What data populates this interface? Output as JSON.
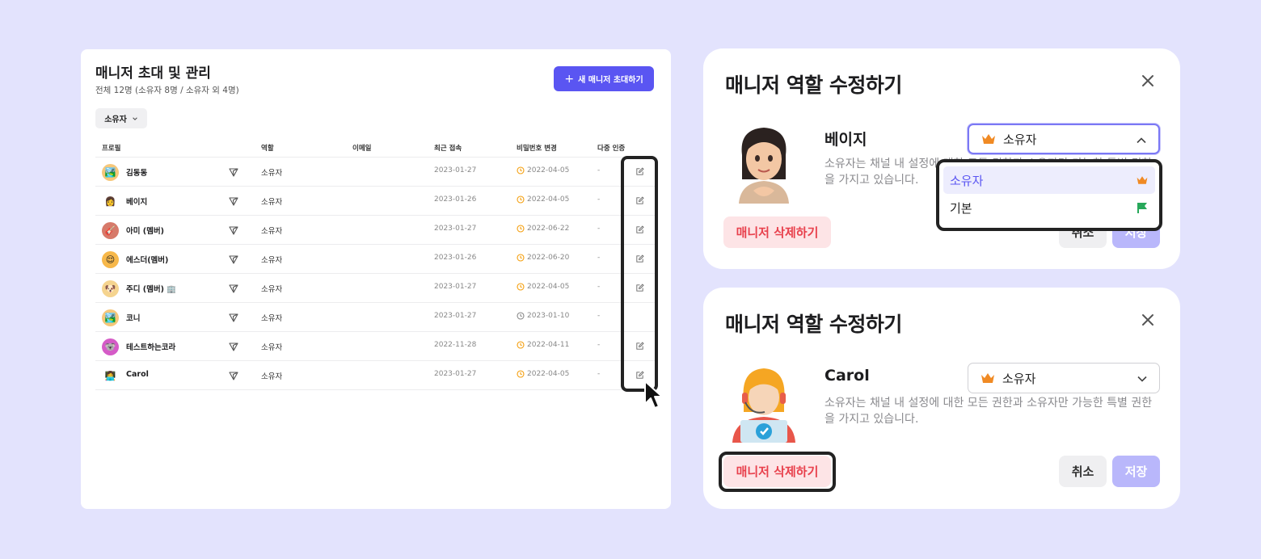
{
  "left_panel": {
    "title": "매니저 초대 및 관리",
    "subtitle": "전체 12명 (소유자 8명 / 소유자 외 4명)",
    "invite_button": "새 매니저 초대하기",
    "filter_label": "소유자",
    "columns": [
      "프로필",
      "역할",
      "이메일",
      "최근 접속",
      "비밀번호 변경",
      "다중 인증"
    ],
    "rows": [
      {
        "name": "김동동",
        "avatar": "🏞️",
        "avatar_bg": "#f6c77a",
        "role": "소유자",
        "last_login": "2023-01-27",
        "pw_changed": "2022-04-05",
        "pw_warn": true,
        "mfa": "-",
        "editable": true
      },
      {
        "name": "베이지",
        "avatar": "👩",
        "avatar_bg": "#ffffff",
        "role": "소유자",
        "last_login": "2023-01-26",
        "pw_changed": "2022-04-05",
        "pw_warn": true,
        "mfa": "-",
        "editable": true
      },
      {
        "name": "아미 (멤버)",
        "avatar": "🎸",
        "avatar_bg": "#d77a6a",
        "role": "소유자",
        "last_login": "2023-01-27",
        "pw_changed": "2022-06-22",
        "pw_warn": true,
        "mfa": "-",
        "editable": true
      },
      {
        "name": "에스더(멤버)",
        "avatar": "😌",
        "avatar_bg": "#f7b84a",
        "role": "소유자",
        "last_login": "2023-01-26",
        "pw_changed": "2022-06-20",
        "pw_warn": true,
        "mfa": "-",
        "editable": true
      },
      {
        "name": "주디 (멤버) 🏢",
        "avatar": "🐶",
        "avatar_bg": "#f5d48f",
        "role": "소유자",
        "last_login": "2023-01-27",
        "pw_changed": "2022-04-05",
        "pw_warn": true,
        "mfa": "-",
        "editable": true
      },
      {
        "name": "코니",
        "avatar": "🏞️",
        "avatar_bg": "#f6c77a",
        "role": "소유자",
        "last_login": "2023-01-27",
        "pw_changed": "2023-01-10",
        "pw_warn": false,
        "mfa": "-",
        "editable": false
      },
      {
        "name": "테스트하는코라",
        "avatar": "🐨",
        "avatar_bg": "#d55bc7",
        "role": "소유자",
        "last_login": "2022-11-28",
        "pw_changed": "2022-04-11",
        "pw_warn": true,
        "mfa": "-",
        "editable": true
      },
      {
        "name": "Carol",
        "avatar": "👩‍💻",
        "avatar_bg": "#ffffff",
        "role": "소유자",
        "last_login": "2023-01-27",
        "pw_changed": "2022-04-05",
        "pw_warn": true,
        "mfa": "-",
        "editable": true
      }
    ]
  },
  "modal_top": {
    "title": "매니저 역할 수정하기",
    "name": "베이지",
    "selected_role": "소유자",
    "description": "소유자는 채널 내 설정에 대한 모든 권한과 소유자만 가능한 특별 권한을 가지고 있습니다.",
    "delete_button": "매니저 삭제하기",
    "cancel_button": "취소",
    "save_button": "저장",
    "dropdown_options": [
      {
        "label": "소유자",
        "icon": "crown-icon",
        "selected": true
      },
      {
        "label": "기본",
        "icon": "flag-icon",
        "selected": false
      }
    ]
  },
  "modal_bottom": {
    "title": "매니저 역할 수정하기",
    "name": "Carol",
    "selected_role": "소유자",
    "description": "소유자는 채널 내 설정에 대한 모든 권한과 소유자만 가능한 특별 권한을 가지고 있습니다.",
    "delete_button": "매니저 삭제하기",
    "cancel_button": "취소",
    "save_button": "저장"
  },
  "colors": {
    "background": "#e3e3fd",
    "accent": "#5a55f2",
    "danger": "#e8414d",
    "warn_clock": "#f59e0b",
    "crown": "#f08a24",
    "flag": "#27a85a"
  }
}
